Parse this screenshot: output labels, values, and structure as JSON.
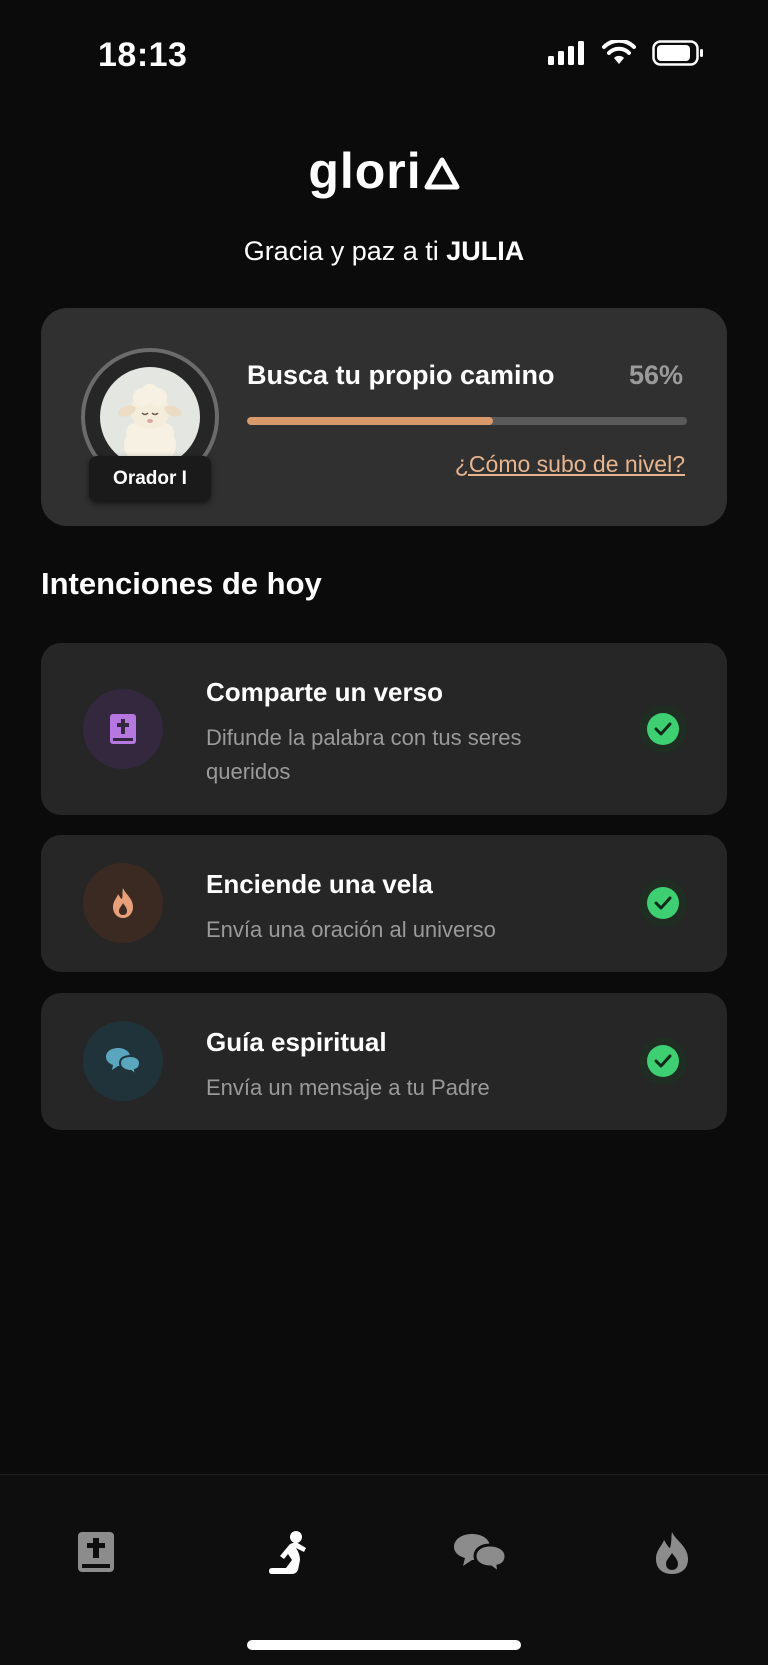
{
  "status_bar": {
    "time": "18:13"
  },
  "app": {
    "logo_text": "glori"
  },
  "greeting": {
    "prefix": "Gracia y paz a ti",
    "name": "JULIA"
  },
  "level": {
    "title": "Busca tu propio camino",
    "percent_label": "56%",
    "progress": 0.56,
    "rank": "Orador I",
    "help_link": "¿Cómo subo de nivel?"
  },
  "intentions": {
    "section_title": "Intenciones de hoy",
    "items": [
      {
        "title": "Comparte un verso",
        "description": "Difunde la palabra con tus seres queridos",
        "icon": "bible-icon",
        "completed": true
      },
      {
        "title": "Enciende una vela",
        "description": "Envía una oración al universo",
        "icon": "flame-icon",
        "completed": true
      },
      {
        "title": "Guía espiritual",
        "description": "Envía un mensaje a tu Padre",
        "icon": "chat-bubbles-icon",
        "completed": true
      }
    ]
  },
  "tabbar": {
    "tabs": [
      {
        "icon": "bible-icon",
        "active": false
      },
      {
        "icon": "praying-person-icon",
        "active": true
      },
      {
        "icon": "chat-bubbles-icon",
        "active": false
      },
      {
        "icon": "flame-icon",
        "active": false
      }
    ]
  },
  "colors": {
    "background": "#0b0b0b",
    "card": "#303030",
    "progress_fill": "#d89a6a",
    "link": "#e7b48e",
    "check": "#3ecf72"
  }
}
